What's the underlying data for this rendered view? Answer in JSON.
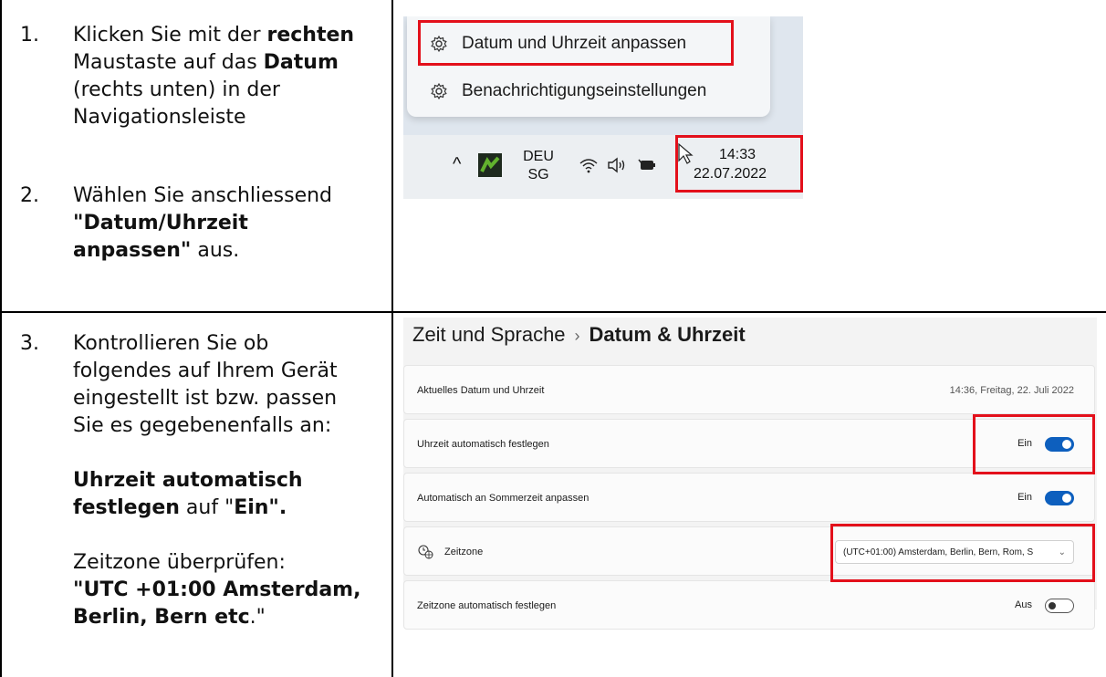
{
  "step1": {
    "num": "1.",
    "line1a": "Klicken Sie mit der ",
    "line1b": "rechten",
    "line2a": "Maustaste auf das ",
    "line2b": "Datum",
    "line3": "(rechts unten) in der",
    "line4": "Navigationsleiste"
  },
  "step2": {
    "num": "2.",
    "line1": "Wählen Sie anschliessend",
    "line2": "\"Datum/Uhrzeit",
    "line3a": "anpassen\"",
    "line3b": " aus."
  },
  "step3": {
    "num": "3.",
    "line1": "Kontrollieren Sie ob",
    "line2": "folgendes auf Ihrem Gerät",
    "line3": "eingestellt ist bzw. passen",
    "line4": "Sie es gegebenenfalls an:",
    "line5": "Uhrzeit automatisch",
    "line6a": "festlegen",
    "line6b": " auf \"",
    "line6c": "Ein\".",
    "line7": "Zeitzone überprüfen:",
    "line8": "\"UTC +01:00 Amsterdam,",
    "line9a": "Berlin, Bern etc",
    "line9b": ".\""
  },
  "context_menu": {
    "item1": "Datum und Uhrzeit anpassen",
    "item2": "Benachrichtigungseinstellungen"
  },
  "taskbar": {
    "lang1": "DEU",
    "lang2": "SG",
    "time": "14:33",
    "date": "22.07.2022"
  },
  "settings": {
    "breadcrumb_parent": "Zeit und Sprache",
    "breadcrumb_sep": "›",
    "breadcrumb_current": "Datum & Uhrzeit",
    "current_label": "Aktuelles Datum und Uhrzeit",
    "current_value": "14:36, Freitag, 22. Juli 2022",
    "auto_time_label": "Uhrzeit automatisch festlegen",
    "auto_time_state": "Ein",
    "dst_label": "Automatisch an Sommerzeit anpassen",
    "dst_state": "Ein",
    "timezone_label": "Zeitzone",
    "timezone_value": "(UTC+01:00) Amsterdam, Berlin, Bern, Rom, S",
    "auto_tz_label": "Zeitzone automatisch festlegen",
    "auto_tz_state": "Aus"
  },
  "colors": {
    "highlight": "#e3101b",
    "toggle_on": "#0d5fbe"
  }
}
